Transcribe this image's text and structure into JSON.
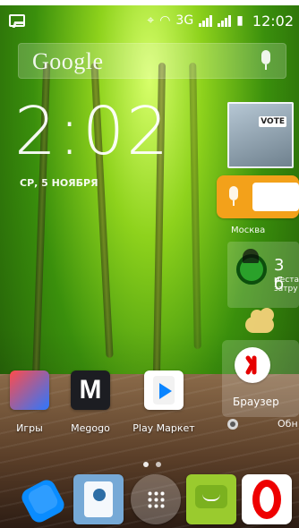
{
  "status": {
    "network": "3G",
    "time": "12:02"
  },
  "search": {
    "logo": "Google",
    "mic_icon": "mic-icon"
  },
  "clock": {
    "time": "2:02",
    "date": "СР, 5 НОЯБРЯ"
  },
  "widgets": {
    "vote_label": "VOTE",
    "city": "Москва",
    "traffic_big": "3 б",
    "traffic_small": "места\nзатру",
    "browser_label": "Браузер",
    "bottom_text": "Обн"
  },
  "apps": [
    {
      "label": "Игры",
      "icon": "games-icon"
    },
    {
      "label": "Megogo",
      "icon": "megogo-icon"
    },
    {
      "label": "Play Маркет",
      "icon": "play-store-icon"
    }
  ],
  "dock": [
    {
      "icon": "phone-icon"
    },
    {
      "icon": "contacts-icon"
    },
    {
      "icon": "app-drawer-icon"
    },
    {
      "icon": "sms-icon"
    },
    {
      "icon": "opera-icon"
    }
  ]
}
